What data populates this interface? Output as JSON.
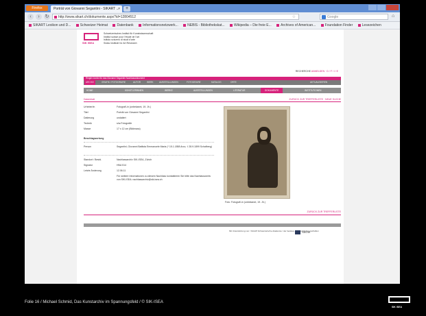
{
  "browser": {
    "app_button": "Firefox",
    "tab_title": "Porträt von Giovanni Segantini - SIKART ...",
    "tab_close": "×",
    "new_tab": "+",
    "url": "http://www.sikart.ch/dokumente.aspx?id=12804512",
    "search_placeholder": "Google",
    "bookmarks": [
      "SIKART Lexikon und D...",
      "Schweizer Heimat",
      "Datenbank",
      "Informationsnetzwerk...",
      "NEBIS - Bibliothekskat...",
      "Wikipedia – Die freie E...",
      "Archives of American...",
      "Foundation Finder",
      "Lesezeichen"
    ]
  },
  "page": {
    "logo_text": "SIK ISEA",
    "institute_lines": [
      "Schweizerisches Institut für Kunstwissenschaft",
      "Institut suisse pour l’étude de l’art",
      "Istituto svizzero di studi d’arte",
      "Swiss Institute for Art Research"
    ],
    "top_right": "RECHERCHE",
    "top_right_links": "ANMELDEN · D / F / I / E",
    "pink_band": "Ringier Archiv für das Giovanni Segantini Nachlassdokument",
    "filter_items": [
      "ARCHIV",
      "GRAFIK / FOTOGRAFIE",
      "AUTOR",
      "WERK",
      "AUSSTELLUNGEN",
      "FOTOGRAFIE",
      "KATALOG",
      "ORTE"
    ],
    "filter_right": "AKTUALISIEREN",
    "main_nav": [
      "HOME",
      "KÜNSTLERINNEN",
      "WERKE",
      "AUSSTELLUNGEN",
      "LITERATUR",
      "DOKUMENTE",
      "INSTITUTIONEN"
    ],
    "main_nav_active": "DOKUMENTE",
    "sub_left": "Datenblatt",
    "sub_right": "ZURÜCK ZUR TREFFERLISTE · NEUE SUCHE",
    "fields": [
      {
        "label": "Urheber/in",
        "value": "Fotograf/-in (unbekannt, 19. Jh.)"
      },
      {
        "label": "Titel",
        "value": "Porträt von Giovanni Segantini"
      },
      {
        "label": "Datierung",
        "value": "undatiert"
      },
      {
        "label": "Technik",
        "value": "s/w-Fotografie"
      },
      {
        "label": "Masse",
        "value": "17 x 12 cm (Bildmass)"
      }
    ],
    "section_title": "Beschlagwortung",
    "person_label": "Person",
    "person_value": "Segantini, Giovanni Battista Emmanuele Maria (* 15.1.1858 Arco, † 28.9.1899 Schafberg)",
    "fields2": [
      {
        "label": "Standort / Bestd.",
        "value": "Nachlassarchiv SIK-ISEA, Zürich"
      },
      {
        "label": "Signatur",
        "value": "HNA 514"
      },
      {
        "label": "Letzte Änderung",
        "value": "12.06.11"
      }
    ],
    "note": "Für weitere Informationen zu diesem Nachlass kontaktieren Sie bitte das Nachlassarchiv von SIK-ISEA: nachlassarchiv@sik-isea.ch",
    "photo_caption": "Foto: Fotograf/-in (unbekannt, 19. Jh.)",
    "bottom_back": "ZURÜCK ZUR TREFFERLISTE",
    "footer_text": "Mit Unterstützung von / SAGW Schweizerische Akademie / der Geistes- und Sozialwissenschaften",
    "sagw": "SAGW"
  },
  "slide": {
    "footer": "Folie 16 / Michael Schmid, Das Kunstarchiv im Spannungsfeld / © SIK-ISEA",
    "badge_text": "SIK ISEA"
  },
  "colors": {
    "accent": "#d6227b",
    "nav_gray": "#8e8e8e",
    "slide_bg": "#000000"
  }
}
